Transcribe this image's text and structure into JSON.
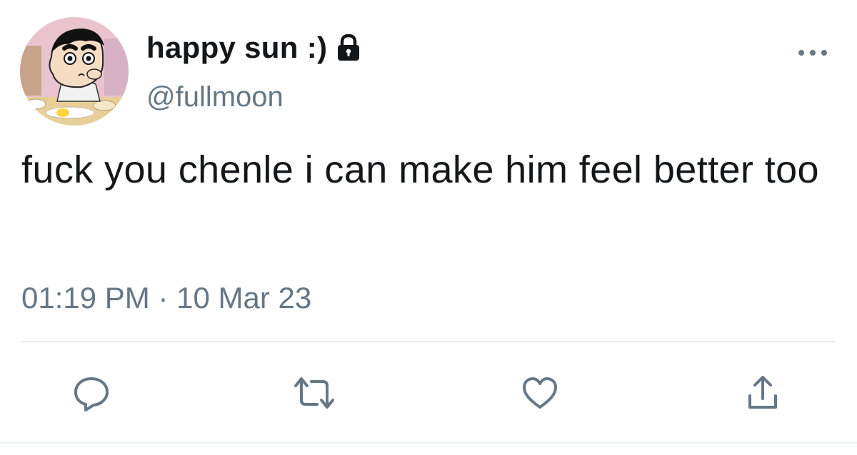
{
  "user": {
    "display_name": "happy sun :)",
    "handle": "@fullmoon",
    "avatar_icon": "cartoon-avatar",
    "protected_icon": "lock-icon"
  },
  "tweet": {
    "text": "fuck you chenle i can make him feel better too",
    "timestamp": "01:19 PM · 10 Mar 23"
  },
  "actions": {
    "reply_icon": "reply-icon",
    "retweet_icon": "retweet-icon",
    "like_icon": "heart-icon",
    "share_icon": "share-icon",
    "more_icon": "more-options-icon"
  },
  "colors": {
    "primary_text": "#14171a",
    "secondary_text": "#657786",
    "icon": "#657786",
    "divider": "#e6ecf0"
  }
}
